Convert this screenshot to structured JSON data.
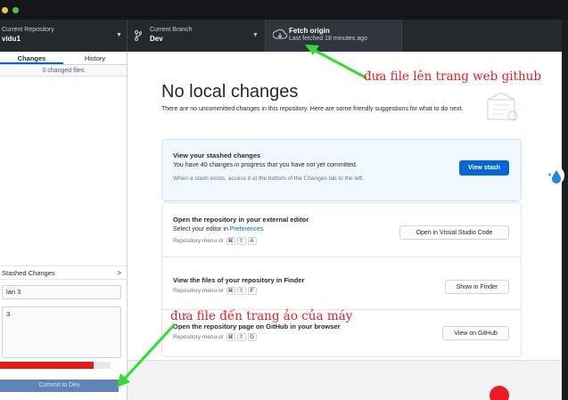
{
  "toolbar": {
    "repo_label": "Current Repository",
    "repo_value": "vidu1",
    "branch_label": "Current Branch",
    "branch_value": "Dev",
    "fetch_label": "Fetch origin",
    "fetch_sub": "Last fetched 18 minutes ago"
  },
  "sidebar": {
    "tabs": [
      "Changes",
      "History"
    ],
    "changed_files": "0 changed files",
    "stashed_label": "Stashed Changes",
    "summary_value": "lan 3",
    "description_value": "3",
    "progress_percent": 85,
    "commit_button": "Commit to Dev"
  },
  "main": {
    "heading": "No local changes",
    "intro": "There are no uncommitted changes in this repository. Here are some friendly suggestions for what to do next.",
    "stash_card": {
      "title": "View your stashed changes",
      "text": "You have 40 changes in progress that you have not yet committed.",
      "hint": "When a stash exists, access it at the bottom of the Changes tab to the left.",
      "button": "View stash"
    },
    "editor_card": {
      "title": "Open the repository in your external editor",
      "text_prefix": "Select your editor in ",
      "text_link": "Preferences",
      "hint": "Repository menu or",
      "keys": [
        "⌘",
        "⇧",
        "A"
      ],
      "button": "Open in Visual Studio Code"
    },
    "finder_card": {
      "title": "View the files of your repository in Finder",
      "hint": "Repository menu or",
      "keys": [
        "⌘",
        "⇧",
        "F"
      ],
      "button": "Show in Finder"
    },
    "github_card": {
      "title": "Open the repository page on GitHub in your browser",
      "hint": "Repository menu or",
      "keys": [
        "⌘",
        "⇧",
        "G"
      ],
      "button": "View on GitHub"
    }
  },
  "annotations": {
    "top": "đưa file lên trang web github",
    "bottom": "đưa file đến trang ảo của  máy",
    "color": "#ee1c24",
    "arrow_color": "#2ee02e"
  },
  "icons": [
    "branch-icon",
    "fetch-icon",
    "chevron-down-icon",
    "chevron-right-icon",
    "repository-illustration"
  ]
}
